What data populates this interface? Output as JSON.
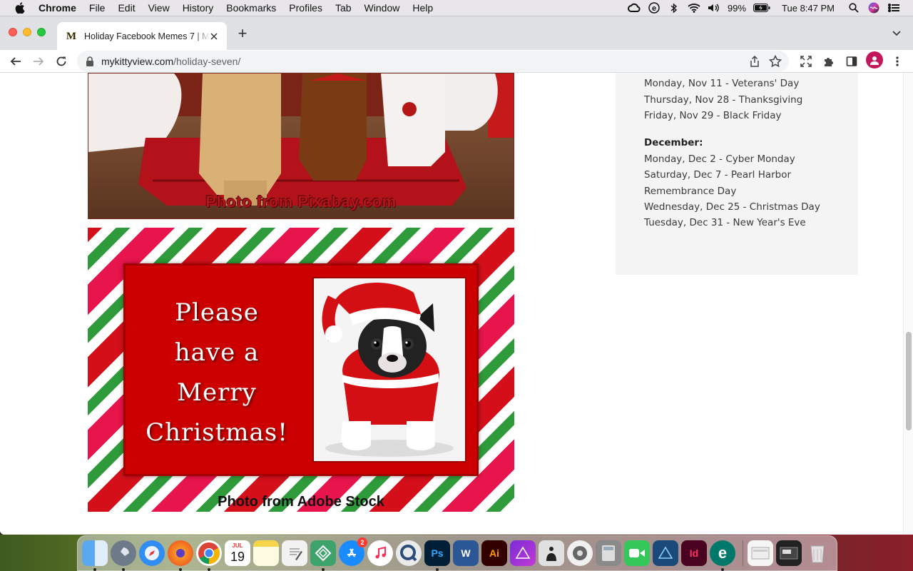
{
  "menubar": {
    "app_name": "Chrome",
    "items": [
      "File",
      "Edit",
      "View",
      "History",
      "Bookmarks",
      "Profiles",
      "Tab",
      "Window",
      "Help"
    ],
    "battery": "99%",
    "clock": "Tue 8:47 PM",
    "status_icons": [
      "creative-cloud-icon",
      "e-app-icon",
      "bluetooth-icon",
      "wifi-icon",
      "volume-icon",
      "battery-icon",
      "search-icon",
      "siri-icon",
      "control-center-icon"
    ]
  },
  "browser": {
    "tab": {
      "favicon": "M",
      "title": "Holiday Facebook Memes 7 | M"
    },
    "address": {
      "domain": "mykittyview.com",
      "path": "/holiday-seven/"
    }
  },
  "page": {
    "photo1_credit": "Photo from Pixabay.com",
    "christmas_card": {
      "greeting": "Please\nhave a\nMerry\nChristmas!",
      "credit": "Photo from Adobe Stock",
      "colors": {
        "red": "#cc0000",
        "green": "#2e9a3a",
        "pink": "#e8144c"
      }
    },
    "sidebar": {
      "november_items": [
        "Monday, Nov 11 - Veterans' Day",
        "Thursday, Nov 28 - Thanksgiving",
        "Friday, Nov 29 - Black Friday"
      ],
      "december_heading": "December:",
      "december_items": [
        "Monday, Dec 2 - Cyber Monday",
        "Saturday, Dec 7 - Pearl Harbor",
        "Remembrance Day",
        "Wednesday, Dec 25 - Christmas Day",
        "Tuesday, Dec 31 - New Year's Eve"
      ]
    }
  },
  "dock": {
    "calendar_month": "JUL",
    "calendar_day": "19",
    "app_store_badge": "2",
    "photoshop_label": "Ps",
    "word_label": "W",
    "illustrator_label": "Ai",
    "indesign_label": "Id",
    "e_app_label": "e"
  }
}
